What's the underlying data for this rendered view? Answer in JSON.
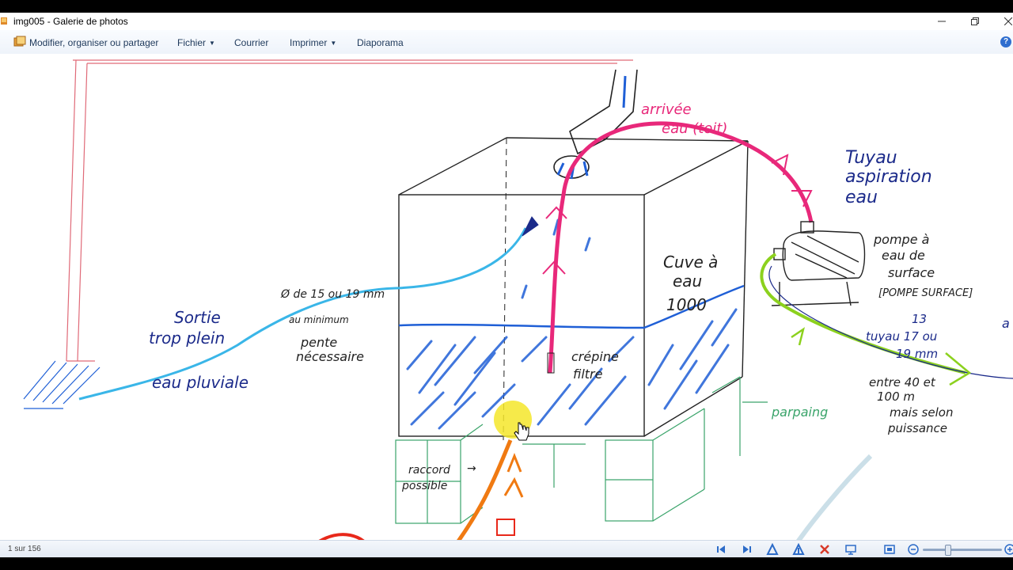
{
  "window": {
    "title": "img005 - Galerie de photos"
  },
  "menubar": {
    "organize": "Modifier, organiser ou partager",
    "file": "Fichier",
    "mail": "Courrier",
    "print": "Imprimer",
    "slideshow": "Diaporama"
  },
  "status": {
    "counter": "1 sur 156"
  },
  "sketch": {
    "arrivee_1": "arrivée",
    "arrivee_2": "eau (toit)",
    "tuyau_1": "Tuyau",
    "tuyau_2": "aspiration",
    "tuyau_3": "eau",
    "pompe_1": "pompe à",
    "pompe_2": "eau de",
    "pompe_3": "surface",
    "pompe_4": "[POMPE SURFACE]",
    "cuve_1": "Cuve à",
    "cuve_2": "eau",
    "cuve_3": "1000",
    "diam_1": "Ø de 15 ou 19 mm",
    "diam_2": "au minimum",
    "pente_1": "pente",
    "pente_2": "nécessaire",
    "sortie_1": "Sortie",
    "sortie_2": "trop plein",
    "pluviale": "eau pluviale",
    "crepine_1": "crépine",
    "crepine_2": "filtre",
    "parpaing": "parpaing",
    "t13_1": "13",
    "t13_2": "tuyau 17 ou",
    "t13_3": "19 mm",
    "entre_1": "entre 40 et",
    "entre_2": "100 m",
    "entre_3": "mais selon",
    "entre_4": "puissance",
    "raccord_1": "raccord",
    "raccord_2": "possible",
    "edge_a": "a"
  },
  "colors": {
    "pink": "#e8287a",
    "blue": "#1f5fd6",
    "cyan": "#3ab6e8",
    "green": "#3aa46a",
    "lime": "#8cd11e",
    "orange": "#f07a12",
    "navy": "#1b2a8a"
  }
}
